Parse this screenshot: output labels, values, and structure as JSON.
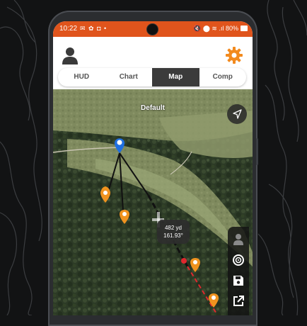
{
  "status_bar": {
    "time": "10:22",
    "left_icons": "✉ ✿ ◘ •",
    "right_icons": "🔇 ⬤ ≋ .ıl",
    "battery": "80%"
  },
  "tabs": [
    {
      "label": "HUD",
      "active": false
    },
    {
      "label": "Chart",
      "active": false
    },
    {
      "label": "Map",
      "active": true
    },
    {
      "label": "Comp",
      "active": false
    }
  ],
  "map": {
    "layer_label": "Default",
    "range_readout": {
      "distance": "482 yd",
      "bearing": "161.93°"
    }
  },
  "colors": {
    "status_bar": "#e0541c",
    "accent": "#f28a1e",
    "tab_active": "#3b3b3b",
    "shot_line": "#e0282e",
    "marker_orange": "#f0931f",
    "marker_blue": "#1f6fe0"
  },
  "icons": {
    "profile": "person-icon",
    "settings": "gear-icon",
    "locate": "navigation-arrow-icon",
    "shooter": "person-icon",
    "target": "target-icon",
    "save": "save-icon",
    "export": "external-link-icon"
  }
}
